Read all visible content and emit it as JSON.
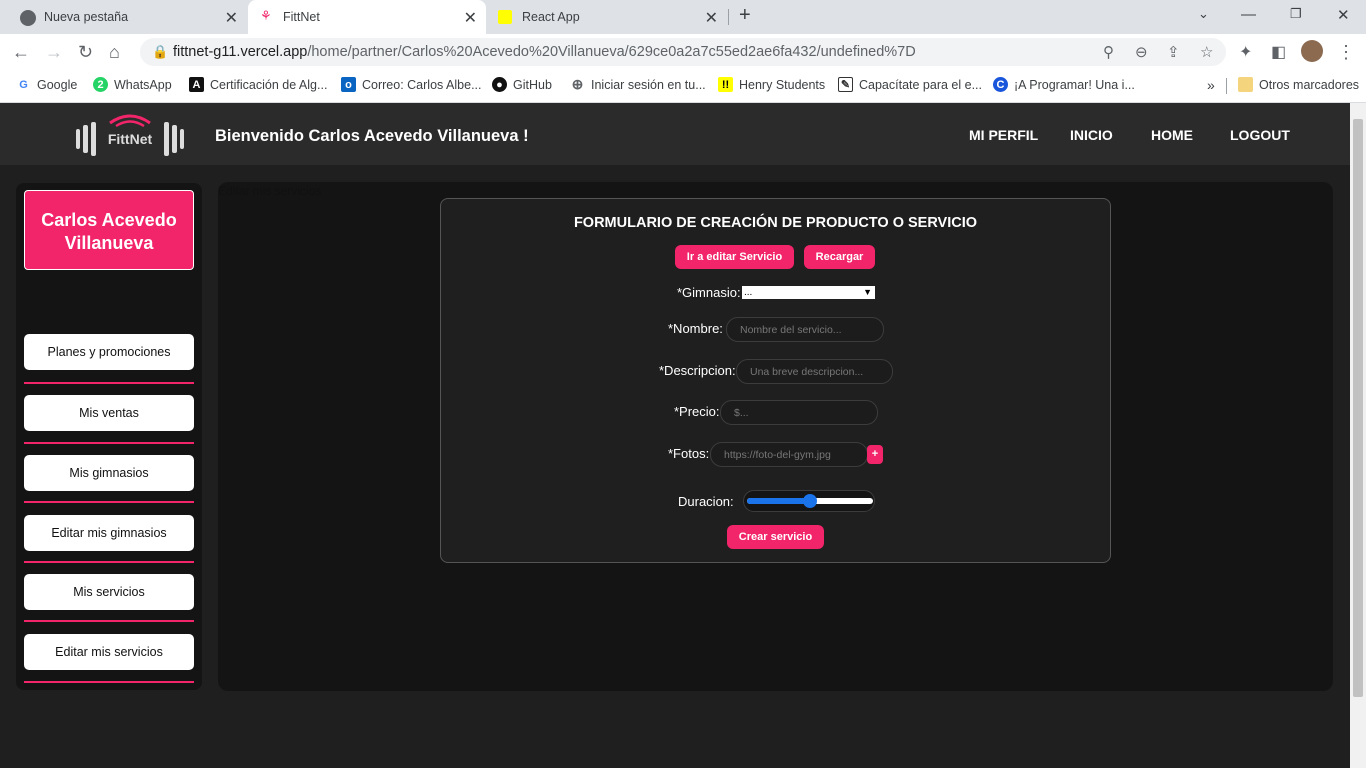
{
  "browser": {
    "tabs": [
      {
        "title": "Nueva pestaña"
      },
      {
        "title": "FittNet"
      },
      {
        "title": "React App"
      }
    ],
    "url_host": "fittnet-g11.vercel.app",
    "url_path": "/home/partner/Carlos%20Acevedo%20Villanueva/629ce0a2a7c55ed2ae6fa432/undefined%7D",
    "bookmarks": [
      {
        "label": "Google",
        "icon": "google-icon"
      },
      {
        "label": "WhatsApp",
        "icon": "whatsapp-icon"
      },
      {
        "label": "Certificación de Alg...",
        "icon": "algorand-icon"
      },
      {
        "label": "Correo: Carlos Albe...",
        "icon": "outlook-icon"
      },
      {
        "label": "GitHub",
        "icon": "github-icon"
      },
      {
        "label": "Iniciar sesión en tu...",
        "icon": "globe-icon"
      },
      {
        "label": "Henry Students",
        "icon": "henry-icon"
      },
      {
        "label": "Capacítate para el e...",
        "icon": "doc-icon"
      },
      {
        "label": "¡A Programar! Una i...",
        "icon": "c-icon"
      }
    ],
    "more_bookmarks": "»",
    "other_bookmarks": "Otros marcadores"
  },
  "header": {
    "logo_text": "FittNet",
    "welcome": "Bienvenido Carlos Acevedo Villanueva !",
    "nav": [
      "MI PERFIL",
      "INICIO",
      "HOME",
      "LOGOUT"
    ]
  },
  "sidebar": {
    "user_name": "Carlos Acevedo Villanueva",
    "items": [
      {
        "label": "Planes y promociones"
      },
      {
        "label": "Mis ventas"
      },
      {
        "label": "Mis gimnasios"
      },
      {
        "label": "Editar mis gimnasios"
      },
      {
        "label": "Mis servicios"
      },
      {
        "label": "Editar mis servicios"
      }
    ]
  },
  "main": {
    "breadcrumb": "Editar mis servicios",
    "form": {
      "title": "FORMULARIO DE CREACIÓN DE PRODUCTO O SERVICIO",
      "edit_button": "Ir a editar Servicio",
      "reload_button": "Recargar",
      "gym_label": "*Gimnasio:",
      "gym_selected": "...",
      "name_label": "*Nombre:",
      "name_placeholder": "Nombre del servicio...",
      "desc_label": "*Descripcion:",
      "desc_placeholder": "Una breve descripcion...",
      "price_label": "*Precio:",
      "price_placeholder": "$...",
      "photos_label": "*Fotos:",
      "photos_placeholder": "https://foto-del-gym.jpg",
      "add_photo": "+",
      "duration_label": "Duracion:",
      "duration_fraction": 0.5,
      "submit_button": "Crear servicio"
    }
  },
  "colors": {
    "accent": "#f2246a",
    "page_bg": "#1f1f1f",
    "panel_bg": "#141414"
  }
}
